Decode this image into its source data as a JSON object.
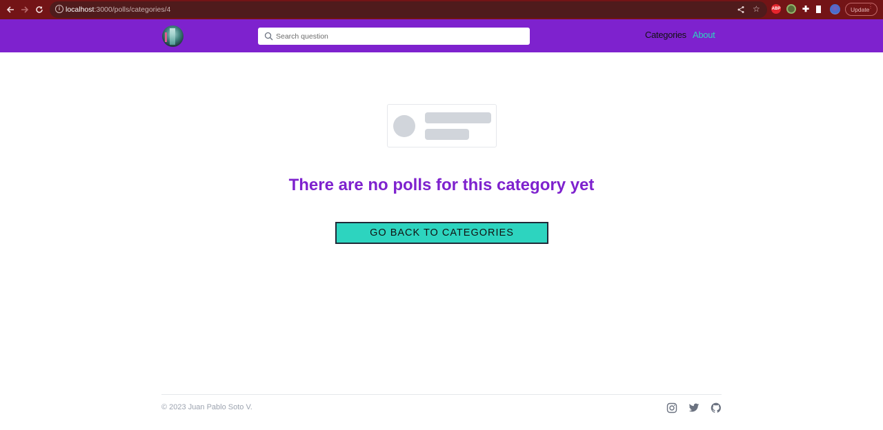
{
  "browser": {
    "url_host": "localhost",
    "url_path": ":3000/polls/categories/4",
    "update_label": "Update",
    "extensions": [
      "abp-icon",
      "target-extension-icon",
      "puzzle-extensions-icon",
      "side-panel-icon",
      "profile-avatar-icon"
    ]
  },
  "header": {
    "search_placeholder": "Search question",
    "search_value": "",
    "nav": [
      {
        "label": "Categories",
        "active": true
      },
      {
        "label": "About",
        "active": false
      }
    ]
  },
  "main": {
    "empty_message": "There are no polls for this category yet",
    "back_button_label": "GO BACK TO CATEGORIES"
  },
  "footer": {
    "copyright": "© 2023 Juan Pablo Soto V.",
    "social": [
      "instagram-icon",
      "twitter-icon",
      "github-icon"
    ]
  },
  "colors": {
    "brand_purple": "#7e22ce",
    "accent_teal": "#2dd4bf",
    "browser_chrome": "#731416"
  }
}
